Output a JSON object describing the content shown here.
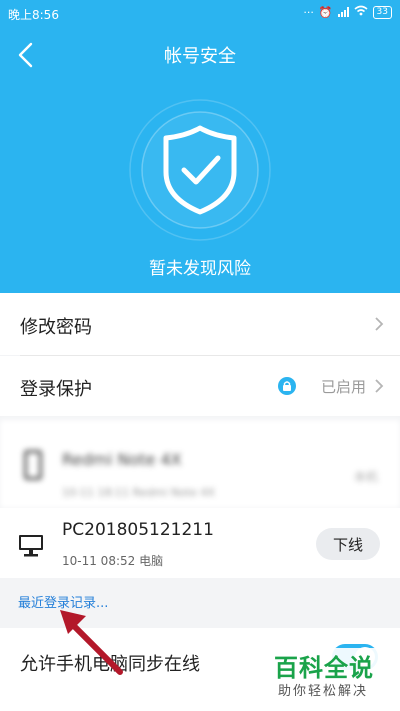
{
  "status_bar": {
    "time": "晚上8:56",
    "battery": "33"
  },
  "header": {
    "title": "帐号安全"
  },
  "hero": {
    "status_text": "暂未发现风险"
  },
  "menu": {
    "change_password": "修改密码",
    "login_protection": "登录保护",
    "login_protection_status": "已启用"
  },
  "devices": {
    "blurred": {
      "name": "Redmi Note 4X",
      "meta": "10-11 18:11 Redmi Note 4X",
      "tag": "本机"
    },
    "current": {
      "name": "PC201805121211",
      "meta": "10-11 08:52 电脑",
      "action": "下线"
    }
  },
  "recent_login_link": "最近登录记录...",
  "sync": {
    "label": "允许手机电脑同步在线",
    "enabled": true
  },
  "watermark": {
    "main": "百科全说",
    "sub": "助你轻松解决"
  },
  "colors": {
    "brand": "#2bb4f0",
    "link": "#2680d9",
    "arrow": "#b3182a",
    "watermark": "#1aa34a"
  }
}
